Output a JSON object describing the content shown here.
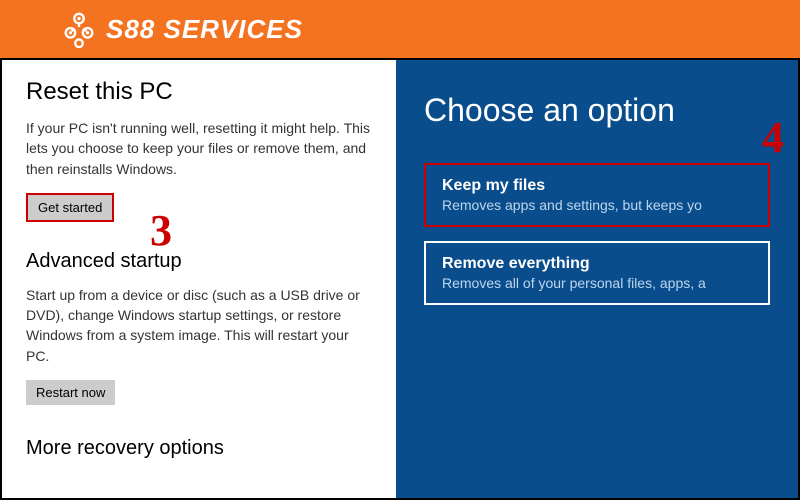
{
  "banner": {
    "brand_text": "S88 SERVICES",
    "accent_color": "#f47321"
  },
  "left": {
    "heading_reset": "Reset this PC",
    "desc_reset": "If your PC isn't running well, resetting it might help. This lets you choose to keep your files or remove them, and then reinstalls Windows.",
    "btn_get_started": "Get started",
    "heading_advanced": "Advanced startup",
    "desc_advanced": "Start up from a device or disc (such as a USB drive or DVD), change Windows startup settings, or restore Windows from a system image. This will restart your PC.",
    "btn_restart": "Restart now",
    "heading_more": "More recovery options"
  },
  "right": {
    "heading": "Choose an option",
    "options": [
      {
        "title": "Keep my files",
        "desc": "Removes apps and settings, but keeps yo"
      },
      {
        "title": "Remove everything",
        "desc": "Removes all of your personal files, apps, a"
      }
    ]
  },
  "annotations": {
    "step3": "3",
    "step4": "4",
    "highlight_color": "#cc0000"
  }
}
